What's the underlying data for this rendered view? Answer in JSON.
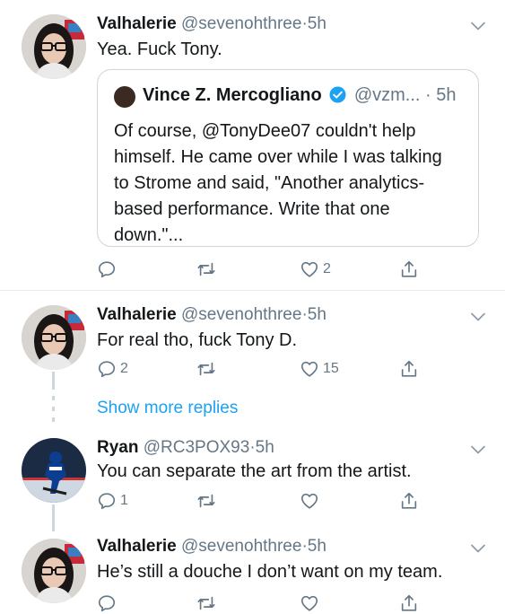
{
  "colors": {
    "accent": "#1da1f2",
    "secondary_text": "#657786",
    "border": "#e6ecf0"
  },
  "tweets": [
    {
      "name": "Valhalerie",
      "handle": "@sevenohthree",
      "dot": "·",
      "time": "5h",
      "text": "Yea. Fuck Tony.",
      "quote": {
        "name": "Vince Z. Mercogliano",
        "handle": "@vzm...",
        "dot": "·",
        "time": "5h",
        "lines": [
          "Of course, @TonyDee07 couldn't help",
          "himself. He came over while I was talking",
          "to Strome and said, \"Another analytics-",
          "based performance. Write that one",
          "down.\"..."
        ]
      },
      "replies": "",
      "retweets": "",
      "likes": "2"
    },
    {
      "name": "Valhalerie",
      "handle": "@sevenohthree",
      "dot": "·",
      "time": "5h",
      "text": "For real tho, fuck Tony D.",
      "replies": "2",
      "retweets": "",
      "likes": "15"
    },
    {
      "name": "Ryan",
      "handle": "@RC3POX93",
      "dot": "·",
      "time": "5h",
      "text": "You can separate the art from the artist.",
      "replies": "1",
      "retweets": "",
      "likes": ""
    },
    {
      "name": "Valhalerie",
      "handle": "@sevenohthree",
      "dot": "·",
      "time": "5h",
      "text": "He’s still a douche I don’t want on my team.",
      "replies": "",
      "retweets": "",
      "likes": ""
    }
  ],
  "show_more": "Show more replies",
  "icons": [
    "reply-icon",
    "retweet-icon",
    "like-icon",
    "share-icon",
    "chevron-down-icon",
    "verified-badge-icon"
  ]
}
